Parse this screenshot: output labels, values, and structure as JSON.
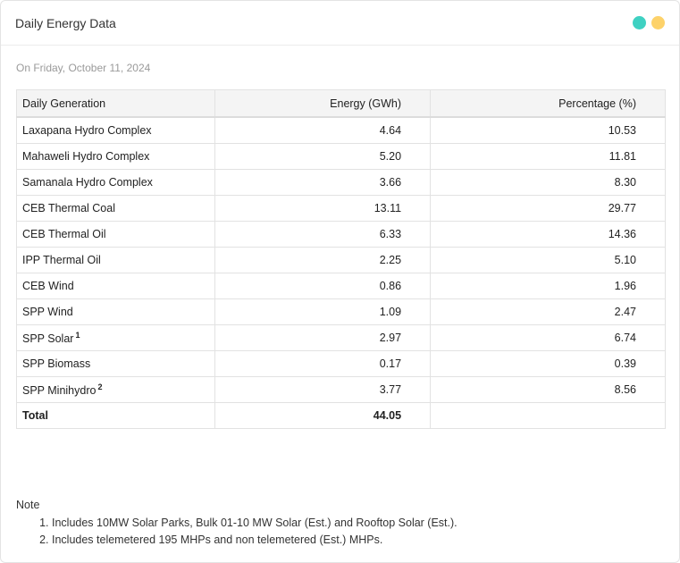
{
  "header": {
    "title": "Daily Energy Data",
    "accent_colors": [
      "#3fd1c2",
      "#fdd26a"
    ]
  },
  "date_line": "On Friday, October 11, 2024",
  "table": {
    "columns": [
      "Daily Generation",
      "Energy (GWh)",
      "Percentage (%)"
    ],
    "rows": [
      {
        "name": "Laxapana Hydro Complex",
        "sup": "",
        "energy": "4.64",
        "percent": "10.53"
      },
      {
        "name": "Mahaweli Hydro Complex",
        "sup": "",
        "energy": "5.20",
        "percent": "11.81"
      },
      {
        "name": "Samanala Hydro Complex",
        "sup": "",
        "energy": "3.66",
        "percent": "8.30"
      },
      {
        "name": "CEB Thermal Coal",
        "sup": "",
        "energy": "13.11",
        "percent": "29.77"
      },
      {
        "name": "CEB Thermal Oil",
        "sup": "",
        "energy": "6.33",
        "percent": "14.36"
      },
      {
        "name": "IPP Thermal Oil",
        "sup": "",
        "energy": "2.25",
        "percent": "5.10"
      },
      {
        "name": "CEB Wind",
        "sup": "",
        "energy": "0.86",
        "percent": "1.96"
      },
      {
        "name": "SPP Wind",
        "sup": "",
        "energy": "1.09",
        "percent": "2.47"
      },
      {
        "name": "SPP Solar",
        "sup": "1",
        "energy": "2.97",
        "percent": "6.74"
      },
      {
        "name": "SPP Biomass",
        "sup": "",
        "energy": "0.17",
        "percent": "0.39"
      },
      {
        "name": "SPP Minihydro",
        "sup": "2",
        "energy": "3.77",
        "percent": "8.56"
      }
    ],
    "total": {
      "label": "Total",
      "energy": "44.05",
      "percent": ""
    }
  },
  "note": {
    "title": "Note",
    "items": [
      "Includes 10MW Solar Parks, Bulk 01-10 MW Solar (Est.) and Rooftop Solar (Est.).",
      "Includes telemetered 195 MHPs and non telemetered (Est.) MHPs."
    ]
  }
}
